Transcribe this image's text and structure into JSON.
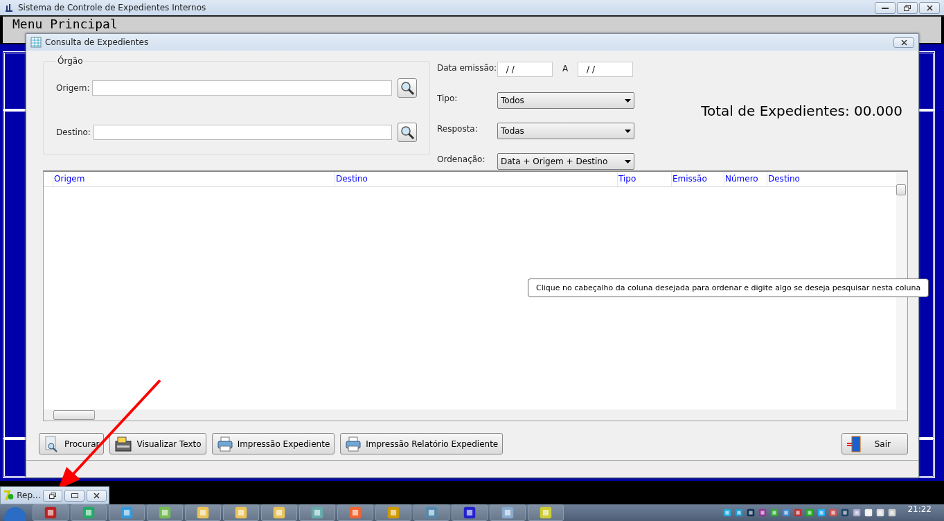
{
  "app": {
    "title": "Sistema de Controle de Expedientes Internos"
  },
  "mdi": {
    "menu_title": "Menu Principal"
  },
  "dialog": {
    "title": "Consulta de Expedientes",
    "orgao": {
      "legend": "Órgão",
      "fields": [
        {
          "label": "Origem:"
        },
        {
          "label": "Destino:"
        }
      ]
    },
    "date": {
      "label": "Data emissão:",
      "from": " / /",
      "separator": "A",
      "to": " / /"
    },
    "selects": [
      {
        "label": "Tipo:",
        "value": "Todos"
      },
      {
        "label": "Resposta:",
        "value": "Todas"
      },
      {
        "label": "Ordenação:",
        "value": "Data + Origem + Destino"
      }
    ],
    "total": "Total de Expedientes: 00.000",
    "columns": [
      "Origem",
      "Destino",
      "Tipo",
      "Emissão",
      "Número",
      "Destino"
    ],
    "tooltip": "Clique no cabeçalho da coluna desejada para ordenar e digite algo se deseja pesquisar nesta coluna",
    "buttons": [
      {
        "label": "Procurar",
        "kind": "search"
      },
      {
        "label": "Visualizar Texto",
        "kind": "drawer"
      },
      {
        "label": "Impressão Expediente",
        "kind": "printer"
      },
      {
        "label": "Impressão Relatório Expediente",
        "kind": "printer"
      }
    ],
    "exit_button": {
      "label": "Sair"
    }
  },
  "minimized": {
    "title": "Rep..."
  },
  "taskbar": {
    "clock": "21:22"
  }
}
